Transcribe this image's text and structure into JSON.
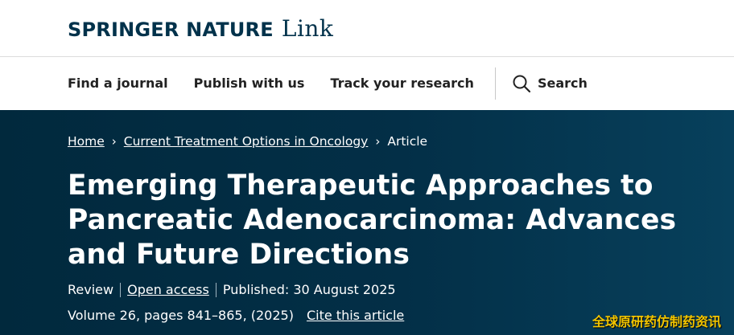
{
  "header": {
    "brand": "SPRINGER NATURE",
    "brand_suffix": "Link"
  },
  "nav": {
    "items": [
      {
        "label": "Find a journal"
      },
      {
        "label": "Publish with us"
      },
      {
        "label": "Track your research"
      }
    ],
    "search_label": "Search"
  },
  "breadcrumb": {
    "home": "Home",
    "journal": "Current Treatment Options in Oncology",
    "current": "Article",
    "separator": "›"
  },
  "article": {
    "title": "Emerging Therapeutic Approaches to Pancreatic Adenocarcinoma: Advances and Future Directions",
    "type": "Review",
    "access": "Open access",
    "published": "Published: 30 August 2025",
    "volume_info": "Volume 26, pages 841–865, (2025)",
    "cite_label": "Cite this article"
  },
  "watermark": "全球原研药仿制药资讯",
  "colors": {
    "brand": "#01324b",
    "hero_bg": "#032f47",
    "watermark": "#f2c500"
  },
  "icons": {
    "search": "search-icon"
  }
}
